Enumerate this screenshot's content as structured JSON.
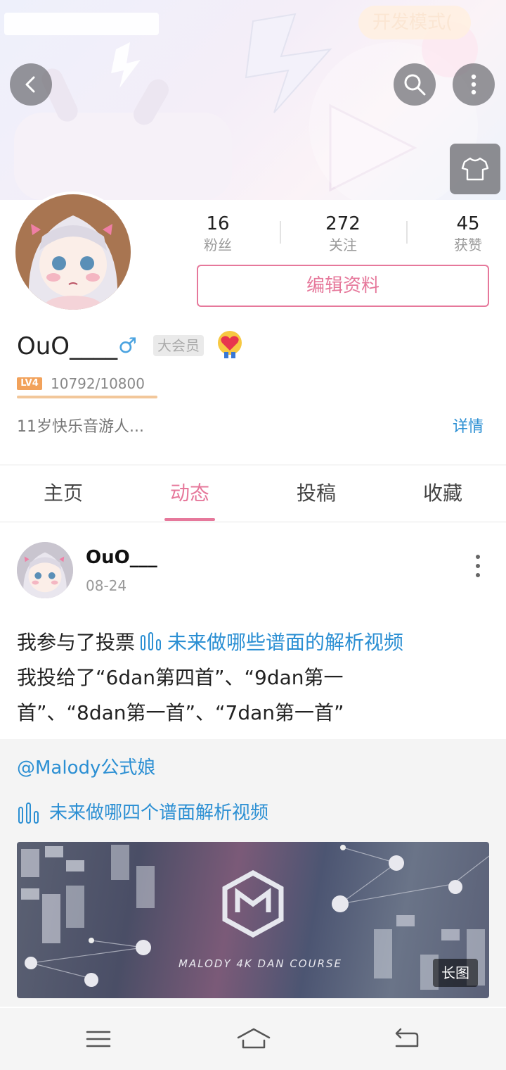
{
  "header": {
    "dev_mode_label": "开发模式(",
    "back_icon": "chevron-left-icon",
    "search_icon": "search-icon",
    "more_icon": "more-vertical-icon",
    "skin_icon": "tshirt-icon"
  },
  "profile": {
    "stats": [
      {
        "value": "16",
        "label": "粉丝"
      },
      {
        "value": "272",
        "label": "关注"
      },
      {
        "value": "45",
        "label": "获赞"
      }
    ],
    "edit_label": "编辑资料",
    "username": "OuO____",
    "gender": "♂",
    "vip_label": "大会员",
    "level_label": "LV4",
    "exp_text": "10792/10800",
    "exp_fraction": 0.999,
    "signature": "11岁快乐音游人...",
    "detail_label": "详情"
  },
  "tabs": [
    {
      "label": "主页"
    },
    {
      "label": "动态"
    },
    {
      "label": "投稿"
    },
    {
      "label": "收藏"
    }
  ],
  "post": {
    "author": "OuO___",
    "date": "08-24",
    "text_prefix": "我参与了投票",
    "vote_link": "未来做哪些谱面的解析视频",
    "text_line2": "我投给了“6dan第四首”、“9dan第一",
    "text_line3": "首”、“8dan第一首”、“7dan第一首”",
    "repost": {
      "mention": "@Malody公式娘",
      "vote_title": "未来做哪四个谱面解析视频",
      "cover_caption": "MALODY 4K DAN COURSE",
      "long_image_label": "长图"
    }
  },
  "navbar": {
    "menu_icon": "menu-icon",
    "home_icon": "home-icon",
    "back_icon": "back-arrow-icon"
  },
  "colors": {
    "accent_pink": "#e6789b",
    "link_blue": "#2b8fd3",
    "level_orange": "#f2a25b"
  }
}
